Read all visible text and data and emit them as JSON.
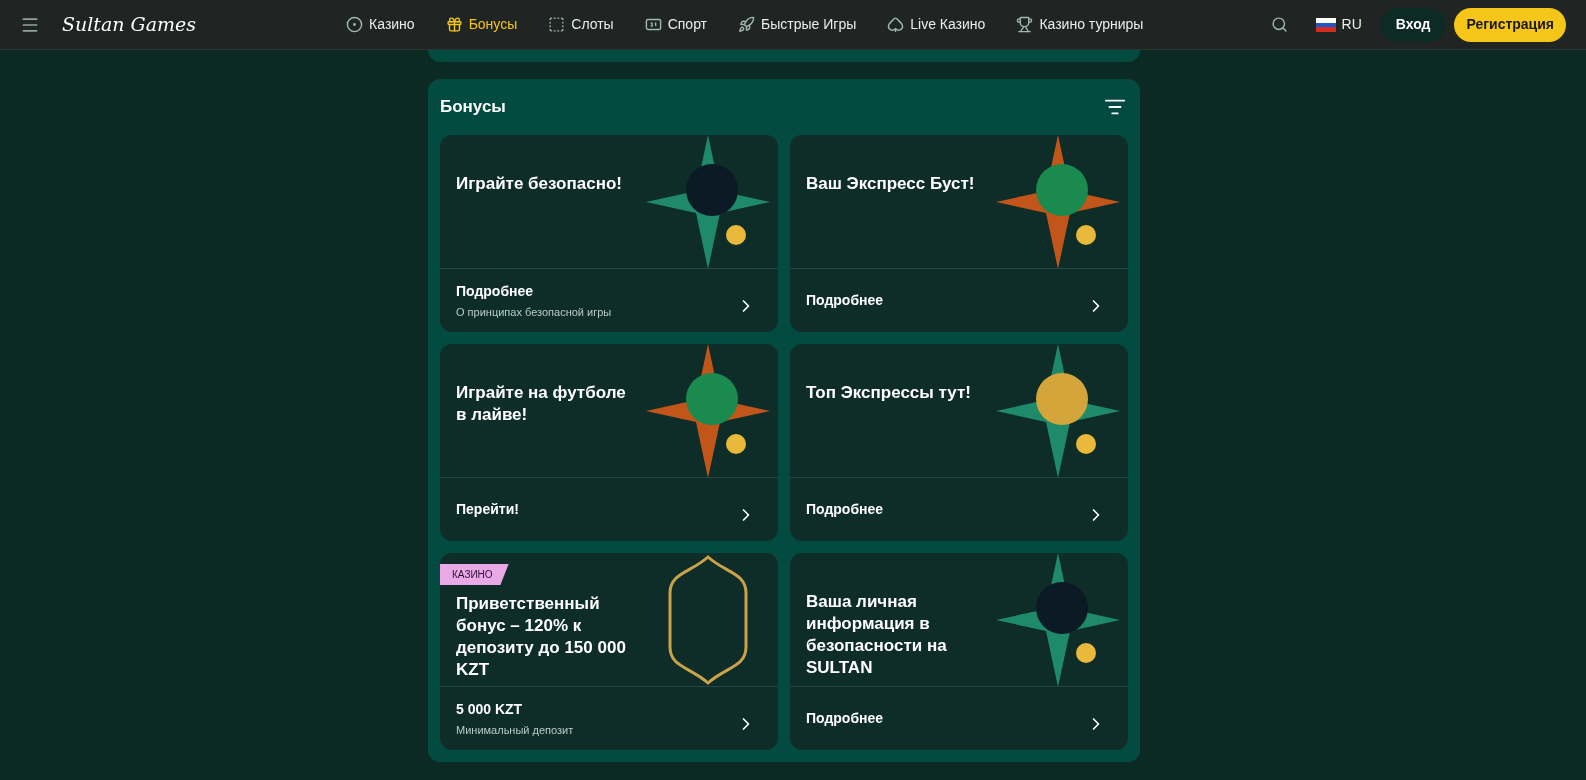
{
  "header": {
    "logo": "Sultan Games",
    "nav": [
      {
        "label": "Казино",
        "selected": false
      },
      {
        "label": "Бонусы",
        "selected": true
      },
      {
        "label": "Слоты",
        "selected": false
      },
      {
        "label": "Спорт",
        "selected": false
      },
      {
        "label": "Быстрые Игры",
        "selected": false
      },
      {
        "label": "Live Казино",
        "selected": false
      },
      {
        "label": "Казино турниры",
        "selected": false
      }
    ],
    "language": "RU",
    "login": "Вход",
    "register": "Регистрация"
  },
  "section": {
    "title": "Бонусы",
    "cards": [
      {
        "title": "Играйте безопасно!",
        "action": "Подробнее",
        "subtitle": "О принципах безопасной игры"
      },
      {
        "title": "Ваш Экспресс Буст!",
        "action": "Подробнее"
      },
      {
        "title": "Играйте на футболе в лайве!",
        "action": "Перейти!"
      },
      {
        "title": "Топ Экспрессы тут!",
        "action": "Подробнее"
      },
      {
        "tag": "КАЗИНО",
        "title": "Приветственный бонус – 120% к депозиту до 150 000 KZT",
        "action": "5 000 KZT",
        "subtitle": "Минимальный депозит"
      },
      {
        "title": "Ваша личная информация в безопасности на SULTAN",
        "action": "Подробнее"
      }
    ]
  }
}
